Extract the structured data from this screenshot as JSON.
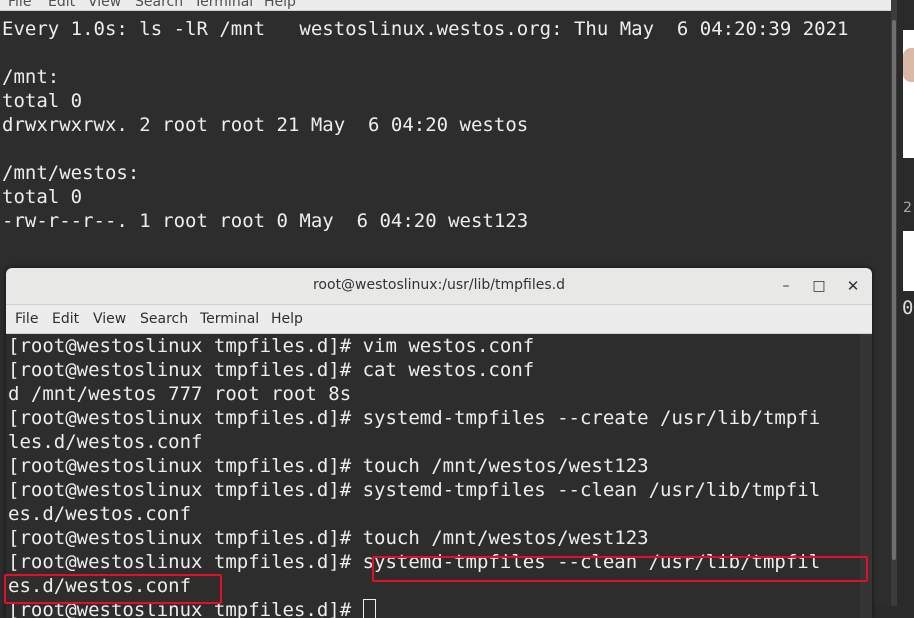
{
  "bg_terminal": {
    "menu": [
      "File",
      "Edit",
      "View",
      "Search",
      "Terminal",
      "Help"
    ],
    "lines": [
      "Every 1.0s: ls -lR /mnt   westoslinux.westos.org: Thu May  6 04:20:39 2021",
      "",
      "/mnt:",
      "total 0",
      "drwxrwxrwx. 2 root root 21 May  6 04:20 westos",
      "",
      "/mnt/westos:",
      "total 0",
      "-rw-r--r--. 1 root root 0 May  6 04:20 west123"
    ]
  },
  "side_window": {
    "char1": "2",
    "char2": "0"
  },
  "fg_terminal": {
    "title": "root@westoslinux:/usr/lib/tmpfiles.d",
    "controls": {
      "minimize": "–",
      "maximize": "□",
      "close": "✕"
    },
    "menu": [
      "File",
      "Edit",
      "View",
      "Search",
      "Terminal",
      "Help"
    ],
    "lines": [
      "[root@westoslinux tmpfiles.d]# vim westos.conf",
      "[root@westoslinux tmpfiles.d]# cat westos.conf",
      "d /mnt/westos 777 root root 8s",
      "[root@westoslinux tmpfiles.d]# systemd-tmpfiles --create /usr/lib/tmpfi",
      "les.d/westos.conf",
      "[root@westoslinux tmpfiles.d]# touch /mnt/westos/west123",
      "[root@westoslinux tmpfiles.d]# systemd-tmpfiles --clean /usr/lib/tmpfil",
      "es.d/westos.conf",
      "[root@westoslinux tmpfiles.d]# touch /mnt/westos/west123",
      "[root@westoslinux tmpfiles.d]# systemd-tmpfiles --clean /usr/lib/tmpfil",
      "es.d/westos.conf"
    ],
    "prompt": "[root@westoslinux tmpfiles.d]# "
  },
  "colors": {
    "terminal_bg": "#2d2d2d",
    "terminal_fg": "#ededed",
    "highlight": "#e0102a",
    "titlebar": "#e8e8e7"
  }
}
